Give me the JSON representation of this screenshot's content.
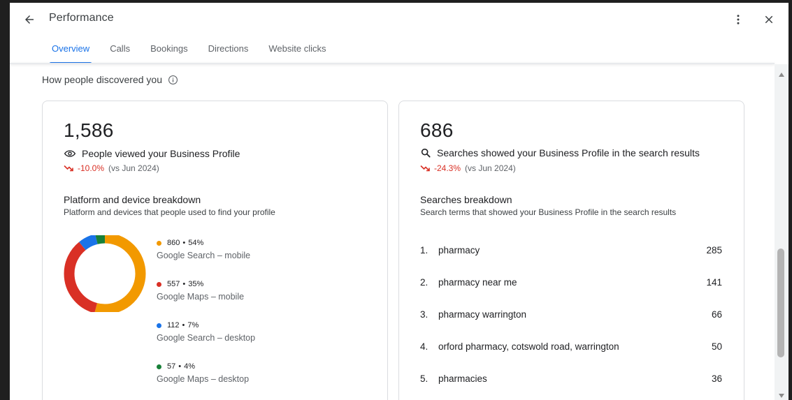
{
  "header": {
    "title": "Performance",
    "tabs": [
      {
        "label": "Overview",
        "active": true
      },
      {
        "label": "Calls",
        "active": false
      },
      {
        "label": "Bookings",
        "active": false
      },
      {
        "label": "Directions",
        "active": false
      },
      {
        "label": "Website clicks",
        "active": false
      }
    ],
    "icons": {
      "back": "arrow-back-icon",
      "more": "more-vert-icon",
      "close": "close-icon"
    }
  },
  "section": {
    "heading": "How people discovered you",
    "icon": "info-icon"
  },
  "views_card": {
    "number": "1,586",
    "icon": "eye-icon",
    "label": "People viewed your Business Profile",
    "trend_percent": "-10.0%",
    "trend_compare": "(vs Jun 2024)",
    "breakdown_title": "Platform and device breakdown",
    "breakdown_desc": "Platform and devices that people used to find your profile",
    "segments": [
      {
        "value": "860",
        "percent": "54%",
        "label": "Google Search – mobile",
        "color": "#f29900",
        "fraction": 0.54
      },
      {
        "value": "557",
        "percent": "35%",
        "label": "Google Maps – mobile",
        "color": "#d93025",
        "fraction": 0.35
      },
      {
        "value": "112",
        "percent": "7%",
        "label": "Google Search – desktop",
        "color": "#1a73e8",
        "fraction": 0.07
      },
      {
        "value": "57",
        "percent": "4%",
        "label": "Google Maps – desktop",
        "color": "#188038",
        "fraction": 0.04
      }
    ],
    "separator": "•"
  },
  "searches_card": {
    "number": "686",
    "icon": "search-icon",
    "label": "Searches showed your Business Profile in the search results",
    "trend_percent": "-24.3%",
    "trend_compare": "(vs Jun 2024)",
    "breakdown_title": "Searches breakdown",
    "breakdown_desc": "Search terms that showed your Business Profile in the search results",
    "terms": [
      {
        "index": "1.",
        "term": "pharmacy",
        "count": "285"
      },
      {
        "index": "2.",
        "term": "pharmacy near me",
        "count": "141"
      },
      {
        "index": "3.",
        "term": "pharmacy warrington",
        "count": "66"
      },
      {
        "index": "4.",
        "term": "orford pharmacy, cotswold road, warrington",
        "count": "50"
      },
      {
        "index": "5.",
        "term": "pharmacies",
        "count": "36"
      }
    ]
  },
  "colors": {
    "accent": "#1a73e8",
    "negative": "#d93025"
  }
}
